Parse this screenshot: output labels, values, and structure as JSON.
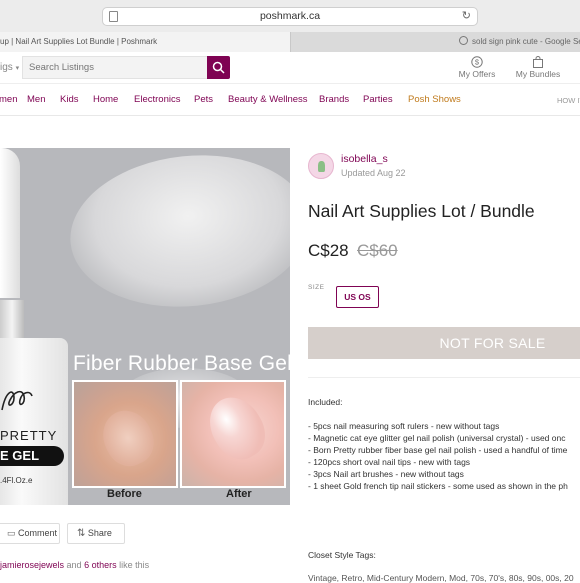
{
  "browser": {
    "url": "poshmark.ca",
    "tabs": [
      {
        "label": "up | Nail Art Supplies Lot Bundle | Poshmark"
      },
      {
        "label": "sold sign pink cute - Google Search"
      }
    ]
  },
  "header": {
    "category_label": "igs",
    "search_placeholder": "Search Listings",
    "my_offers": "My Offers",
    "my_bundles": "My Bundles"
  },
  "nav": {
    "items": [
      "men",
      "Men",
      "Kids",
      "Home",
      "Electronics",
      "Pets",
      "Beauty & Wellness",
      "Brands",
      "Parties",
      "Posh Shows"
    ],
    "how_it_works": "HOW IT"
  },
  "image": {
    "overlay_title": "Fiber Rubber Base Gel",
    "bottle_line1": "PRETTY",
    "bottle_band": "E GEL",
    "bottle_volume": ".4Fl.Oz.e",
    "before_label": "Before",
    "after_label": "After"
  },
  "actions": {
    "comment": "Comment",
    "share": "Share"
  },
  "likes": {
    "user": "jamierosejewels",
    "and": " and ",
    "others": "6 others",
    "suffix": " like this"
  },
  "seller": {
    "username": "isobella_s",
    "updated": "Updated Aug 22"
  },
  "listing": {
    "title": "Nail Art Supplies Lot / Bundle",
    "price": "C$28",
    "original_price": "C$60",
    "size_label": "SIZE",
    "size_value": "US OS",
    "status_button": "NOT FOR SALE"
  },
  "description": {
    "lines": [
      "Included:",
      "",
      "- 5pcs nail measuring soft rulers - new without tags",
      "- Magnetic cat eye glitter gel nail polish (universal crystal) - used onc",
      "- Born Pretty rubber fiber base gel nail polish - used a handful of time",
      "- 120pcs short oval nail tips - new with tags",
      "- 3pcs Nail art brushes - new without tags",
      "- 1 sheet Gold french tip nail stickers - some used as shown in the ph"
    ],
    "closet_tags_label": "Closet Style Tags:",
    "tags_line": "Vintage, Retro, Mid-Century Modern, Mod, 70s, 70's, 80s, 90s, 00s, 20"
  },
  "colors": {
    "brand": "#7f0353",
    "posh_shows": "#c07a1c",
    "disabled_button": "#d6cfcb"
  }
}
